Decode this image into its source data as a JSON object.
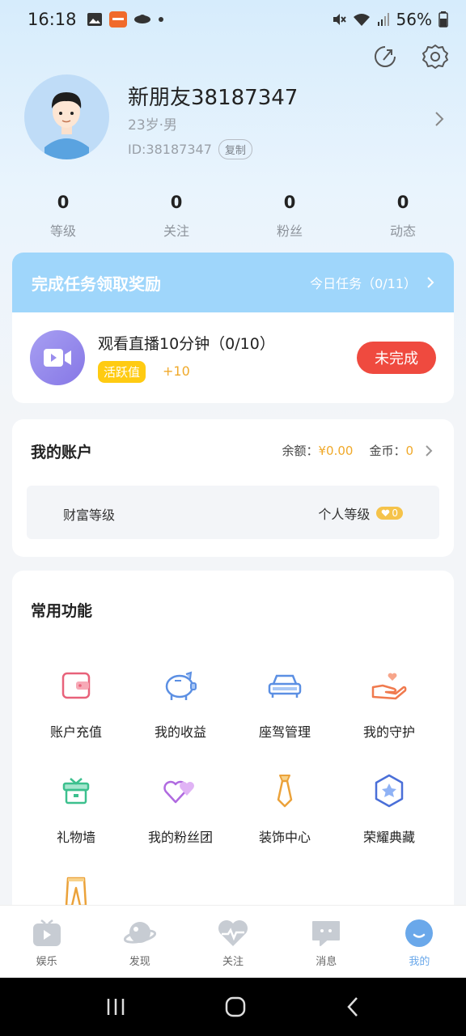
{
  "status": {
    "time": "16:18",
    "battery": "56%"
  },
  "profile": {
    "name": "新朋友38187347",
    "info": "23岁·男",
    "id": "ID:38187347",
    "copy": "复制"
  },
  "stats": [
    {
      "value": "0",
      "label": "等级"
    },
    {
      "value": "0",
      "label": "关注"
    },
    {
      "value": "0",
      "label": "粉丝"
    },
    {
      "value": "0",
      "label": "动态"
    }
  ],
  "tasks": {
    "header": "完成任务领取奖励",
    "today": "今日任务（0/11）",
    "item": {
      "name": "观看直播10分钟（0/10）",
      "badge": "活跃值",
      "reward": "+10",
      "button": "未完成"
    }
  },
  "account": {
    "title": "我的账户",
    "balance_label": "余额：",
    "balance_value": "¥0.00",
    "coin_label": "金币：",
    "coin_value": "0",
    "wealth_level": "财富等级",
    "personal_level": "个人等级",
    "personal_level_value": "0"
  },
  "functions": {
    "title": "常用功能",
    "items": [
      {
        "label": "账户充值",
        "icon": "wallet-icon"
      },
      {
        "label": "我的收益",
        "icon": "piggy-bank-icon"
      },
      {
        "label": "座驾管理",
        "icon": "car-icon"
      },
      {
        "label": "我的守护",
        "icon": "hand-heart-icon"
      },
      {
        "label": "礼物墙",
        "icon": "gift-icon"
      },
      {
        "label": "我的粉丝团",
        "icon": "hearts-icon"
      },
      {
        "label": "装饰中心",
        "icon": "tie-icon"
      },
      {
        "label": "荣耀典藏",
        "icon": "star-badge-icon"
      },
      {
        "label": "",
        "icon": "pants-icon"
      }
    ]
  },
  "tabs": [
    {
      "label": "娱乐"
    },
    {
      "label": "发现"
    },
    {
      "label": "关注"
    },
    {
      "label": "消息"
    },
    {
      "label": "我的"
    }
  ],
  "colors": {
    "accent": "#9fd6fb",
    "danger": "#ef4a3f",
    "gold": "#f0a92a",
    "badge": "#ffcb12",
    "active_tab": "#6aa8ea"
  }
}
